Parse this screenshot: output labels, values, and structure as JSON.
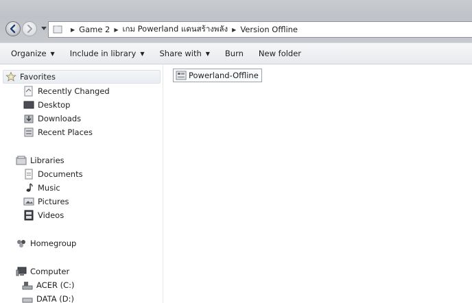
{
  "address": {
    "crumbs": [
      "Game 2",
      "เกม Powerland แดนสร้างพลัง",
      "Version Offline"
    ]
  },
  "commandbar": {
    "organize": "Organize",
    "include_in_library": "Include in library",
    "share_with": "Share with",
    "burn": "Burn",
    "new_folder": "New folder"
  },
  "navpane": {
    "favorites": {
      "label": "Favorites",
      "items": [
        "Recently Changed",
        "Desktop",
        "Downloads",
        "Recent Places"
      ]
    },
    "libraries": {
      "label": "Libraries",
      "items": [
        "Documents",
        "Music",
        "Pictures",
        "Videos"
      ]
    },
    "homegroup": {
      "label": "Homegroup"
    },
    "computer": {
      "label": "Computer",
      "items": [
        "ACER (C:)",
        "DATA (D:)"
      ]
    }
  },
  "content": {
    "items": [
      {
        "name": "Powerland-Offline",
        "icon": "shortcut-icon"
      }
    ]
  },
  "colors": {
    "titlebar": "#c6c9ce",
    "commandbar": "#eef0f3",
    "selection_border": "#9aa3ad"
  }
}
